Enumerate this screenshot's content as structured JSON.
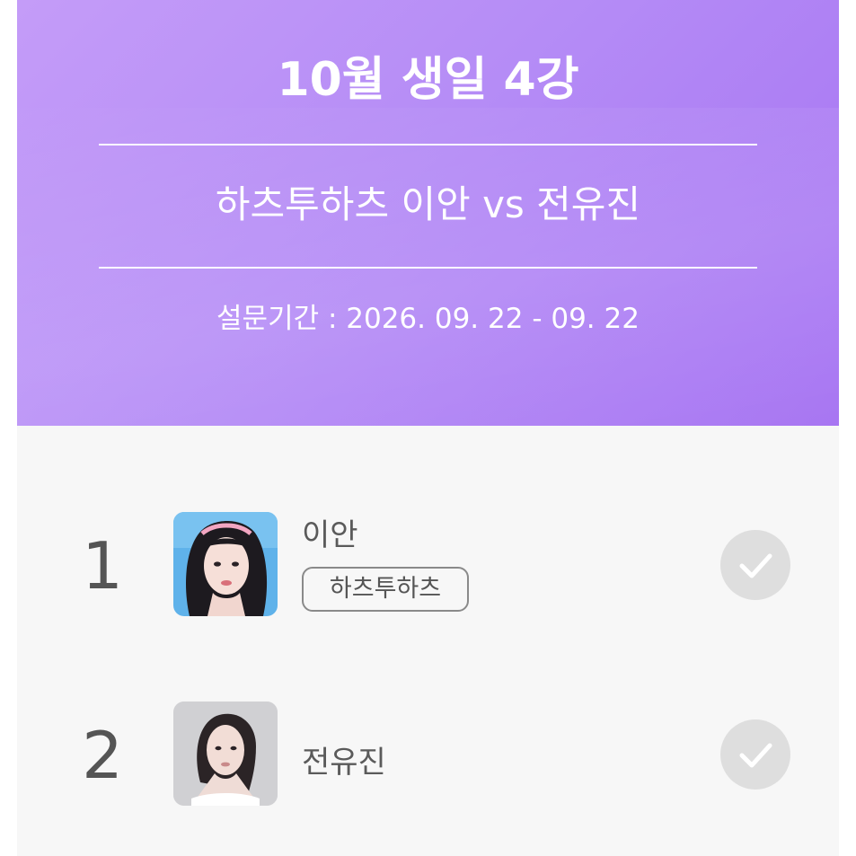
{
  "header": {
    "title": "10월 생일 4강",
    "matchup": "하츠투하츠 이안 vs 전유진",
    "period": "설문기간 : 2026. 09. 22 - 09. 22"
  },
  "candidates": [
    {
      "rank": "1",
      "name": "이안",
      "tag": "하츠투하츠",
      "avatar": "portrait-ian"
    },
    {
      "rank": "2",
      "name": "전유진",
      "avatar": "portrait-jeon-yujin"
    }
  ],
  "icons": {
    "vote": "check-circle-icon"
  },
  "colors": {
    "header_gradient_start": "#c49cf8",
    "header_gradient_end": "#a572f2",
    "check_bg": "#dedede"
  }
}
